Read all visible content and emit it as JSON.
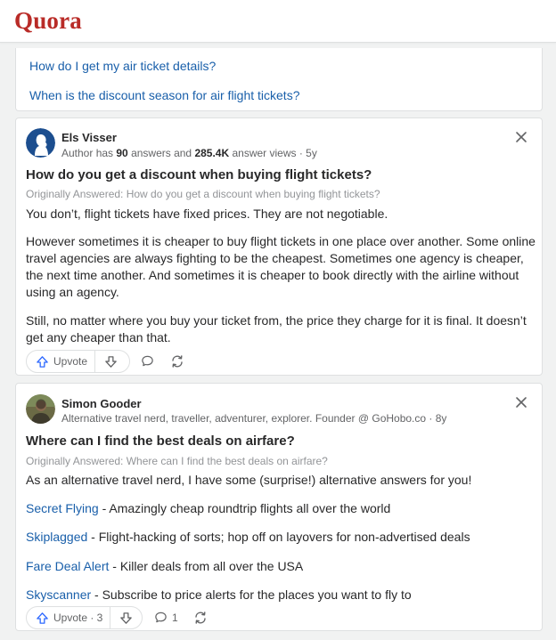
{
  "app": {
    "logo": "Quora",
    "brand_color": "#b92b27",
    "link_color": "#195faa"
  },
  "related": {
    "links": [
      "How do I get my air ticket details?",
      "When is the discount season for air flight tickets?"
    ]
  },
  "answers": [
    {
      "author": "Els Visser",
      "credential_prefix": "Author has ",
      "answers_count": "90",
      "credential_mid": " answers and ",
      "views": "285.4K",
      "credential_suffix": " answer views · 5y",
      "question": "How do you get a discount when buying flight tickets?",
      "originally_answered": "Originally Answered: How do you get a discount when buying flight tickets?",
      "paragraphs": [
        "You don’t, flight tickets have fixed prices. They are not negotiable.",
        "However sometimes it is cheaper to buy flight tickets in one place over another. Some online travel agencies are always fighting to be the cheapest. Sometimes one agency is cheaper, the next time another. And sometimes it is cheaper to book directly with the airline without using an agency.",
        "Still, no matter where you buy your ticket from, the price they charge for it is final. It doesn’t get any cheaper than that."
      ],
      "upvote_label": "Upvote",
      "avatar_icon": "person-silhouette-icon"
    },
    {
      "author": "Simon Gooder",
      "credential": "Alternative travel nerd, traveller, adventurer, explorer. Founder @ GoHobo.co · 8y",
      "question": "Where can I find the best deals on airfare?",
      "originally_answered": "Originally Answered: Where can I find the best deals on airfare?",
      "intro": "As an alternative travel nerd, I have some (surprise!) alternative answers for you!",
      "items": [
        {
          "link": "Secret Flying",
          "text": " - Amazingly cheap roundtrip flights all over the world"
        },
        {
          "link": "Skiplagged",
          "text": " - Flight-hacking of sorts; hop off on layovers for non-advertised deals"
        },
        {
          "link": "Fare Deal Alert",
          "text": " - Killer deals from all over the USA"
        },
        {
          "link": "Skyscanner",
          "text": " - Subscribe to price alerts for the places you want to fly to"
        }
      ],
      "upvote_label": "Upvote · 3",
      "comment_count": "1",
      "avatar_icon": "profile-photo-icon"
    }
  ]
}
